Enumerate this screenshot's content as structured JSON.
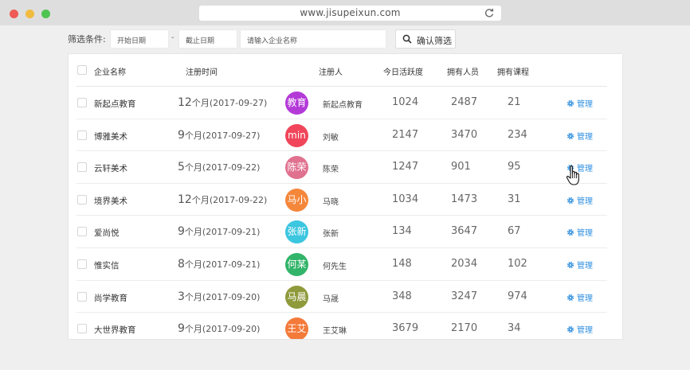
{
  "browser": {
    "url": "www.jisupeixun.com"
  },
  "filter": {
    "label": "筛选条件:",
    "start_placeholder": "开始日期",
    "separator": "-",
    "end_placeholder": "截止日期",
    "company_placeholder": "请输入企业名称",
    "confirm_label": "确认筛选"
  },
  "table": {
    "headers": {
      "name": "企业名称",
      "date": "注册时间",
      "registrant": "注册人",
      "activity": "今日活跃度",
      "members": "拥有人员",
      "courses": "拥有课程"
    },
    "manage_label": "管理",
    "rows": [
      {
        "name": "新起点教育",
        "day": "12",
        "date_rest": "个月(2017-09-27)",
        "avatar_text": "教育",
        "avatar_color": "#b43ad8",
        "registrant": "新起点教育",
        "activity": "1024",
        "members": "2487",
        "courses": "21"
      },
      {
        "name": "博雅美术",
        "day": "9",
        "date_rest": "个月(2017-09-27)",
        "avatar_text": "min",
        "avatar_color": "#f0455a",
        "registrant": "刘敏",
        "activity": "2147",
        "members": "3470",
        "courses": "234"
      },
      {
        "name": "云轩美术",
        "day": "5",
        "date_rest": "个月(2017-09-22)",
        "avatar_text": "陈荣",
        "avatar_color": "#e0718f",
        "registrant": "陈荣",
        "activity": "1247",
        "members": "901",
        "courses": "95"
      },
      {
        "name": "境界美术",
        "day": "12",
        "date_rest": "个月(2017-09-22)",
        "avatar_text": "马小",
        "avatar_color": "#f5873b",
        "registrant": "马晓",
        "activity": "1034",
        "members": "1473",
        "courses": "31"
      },
      {
        "name": "爱尚悦",
        "day": "9",
        "date_rest": "个月(2017-09-21)",
        "avatar_text": "张新",
        "avatar_color": "#3cc6e0",
        "registrant": "张新",
        "activity": "134",
        "members": "3647",
        "courses": "67"
      },
      {
        "name": "惟实信",
        "day": "8",
        "date_rest": "个月(2017-09-21)",
        "avatar_text": "何某",
        "avatar_color": "#32b46a",
        "registrant": "何先生",
        "activity": "148",
        "members": "2034",
        "courses": "102"
      },
      {
        "name": "尚学教育",
        "day": "3",
        "date_rest": "个月(2017-09-20)",
        "avatar_text": "马晨",
        "avatar_color": "#8f9a3b",
        "registrant": "马晟",
        "activity": "348",
        "members": "3247",
        "courses": "974"
      },
      {
        "name": "大世界教育",
        "day": "9",
        "date_rest": "个月(2017-09-20)",
        "avatar_text": "王艾",
        "avatar_color": "#f47a3a",
        "registrant": "王艾琳",
        "activity": "3679",
        "members": "2170",
        "courses": "34"
      }
    ]
  },
  "colors": {
    "accent": "#2f8fe0"
  }
}
